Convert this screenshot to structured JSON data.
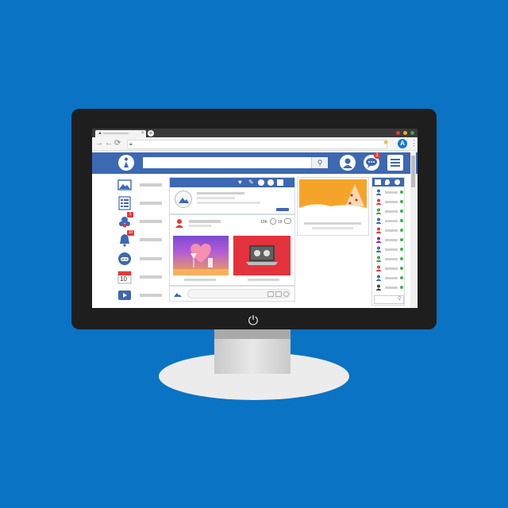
{
  "scene": {
    "background_color": "#0a73c4",
    "monitor_color": "#1e1e1e"
  },
  "monitor": {
    "power_icon": "power-icon",
    "power_glyph": "⏻"
  },
  "browser": {
    "tab_close_glyph": "×",
    "new_tab_glyph": "+",
    "back_glyph": "←",
    "forward_glyph": "→",
    "reload_glyph": "⟳",
    "bookmark_glyph": "★",
    "profile_initial": "A",
    "menu_glyph": "⋮",
    "window_dots": [
      "#e53935",
      "#f9a825",
      "#43a047"
    ]
  },
  "app": {
    "accent_color": "#3d68b2",
    "search_glyph": "⚲",
    "chat_badge": "1"
  },
  "sidebar": {
    "items": [
      {
        "icon": "photo-icon"
      },
      {
        "icon": "list-icon"
      },
      {
        "icon": "group-icon",
        "badge": "1"
      },
      {
        "icon": "notification-bell-icon",
        "badge": "10"
      },
      {
        "icon": "gamepad-icon"
      },
      {
        "icon": "calendar-icon",
        "label": "10"
      },
      {
        "icon": "video-play-icon"
      }
    ]
  },
  "feed": {
    "post": {
      "likes": "10K",
      "comments": "18"
    }
  }
}
